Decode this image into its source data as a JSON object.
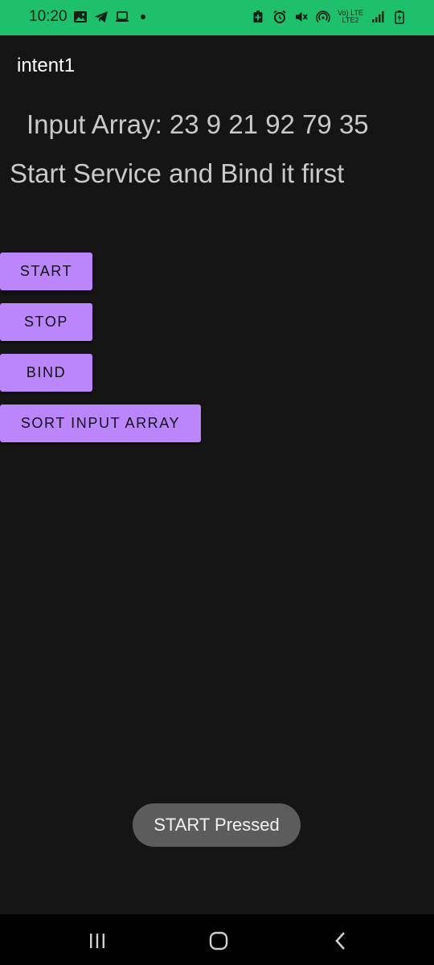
{
  "status_bar": {
    "time": "10:20",
    "network_label_top": "Vo) LTE",
    "network_label_bottom": "LTE2",
    "left_icons": [
      "gallery-icon",
      "telegram-icon",
      "laptop-icon",
      "dot"
    ],
    "right_icons": [
      "battery-saver-icon",
      "alarm-icon",
      "mute-icon",
      "hotspot-icon",
      "volte-icon",
      "signal-icon",
      "battery-charging-icon"
    ],
    "background": "#1fc06b"
  },
  "app_bar": {
    "title": "intent1"
  },
  "main": {
    "input_array_text": "Input Array:  23 9 21 92 79 35",
    "service_message": "Start Service and Bind it first",
    "buttons": {
      "start": "START",
      "stop": "STOP",
      "bind": "BIND",
      "sort": "SORT INPUT ARRAY"
    },
    "button_color": "#bb86fc"
  },
  "toast": {
    "text": "START Pressed"
  },
  "nav_bar": {
    "icons": [
      "recents-icon",
      "home-icon",
      "back-icon"
    ]
  }
}
